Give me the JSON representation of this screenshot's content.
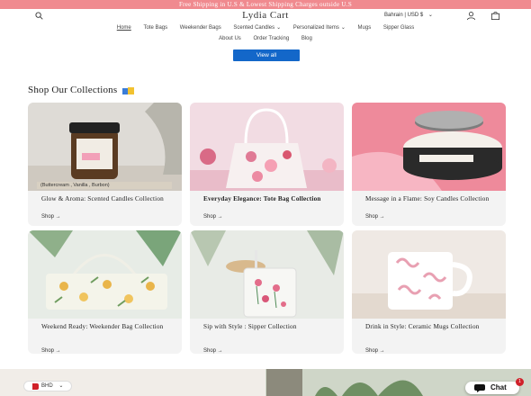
{
  "announcement": "Free Shipping in U.S & Lowest Shipping Charges outside U.S",
  "header": {
    "logo": "Lydia Cart",
    "country_selector": "Bahrain | USD $",
    "icons": [
      "search-icon",
      "user-icon",
      "cart-icon"
    ]
  },
  "nav": {
    "row1": [
      {
        "label": "Home",
        "active": true
      },
      {
        "label": "Tote Bags"
      },
      {
        "label": "Weekender Bags"
      },
      {
        "label": "Scented Candles",
        "dropdown": true
      },
      {
        "label": "Personalized Items",
        "dropdown": true
      },
      {
        "label": "Mugs"
      },
      {
        "label": "Sipper Glass"
      }
    ],
    "row2": [
      {
        "label": "About Us"
      },
      {
        "label": "Order Tracking"
      },
      {
        "label": "Blog"
      }
    ]
  },
  "view_all": "View all",
  "section_title": "Shop Our Collections",
  "collections": [
    {
      "title": "Glow & Aroma: Scented Candles Collection",
      "shop": "Shop →",
      "image_caption": "(Buttercream , Vanilla , Burbon)"
    },
    {
      "title": "Everyday Elegance: Tote Bag Collection",
      "shop": "Shop →"
    },
    {
      "title": "Message in a Flame: Soy Candles Collection",
      "shop": "Shop →"
    },
    {
      "title": "Weekend Ready: Weekender Bag Collection",
      "shop": "Shop →"
    },
    {
      "title": "Sip with Style : Sipper Collection",
      "shop": "Shop →"
    },
    {
      "title": "Drink in Style: Ceramic Mugs Collection",
      "shop": "Shop →"
    }
  ],
  "currency_widget": "BHD",
  "chat": {
    "label": "Chat",
    "badge": "1"
  },
  "colors": {
    "announcement_bg": "#f08a8f",
    "button_blue": "#1367c9",
    "card_bg": "#f3f3f3"
  }
}
